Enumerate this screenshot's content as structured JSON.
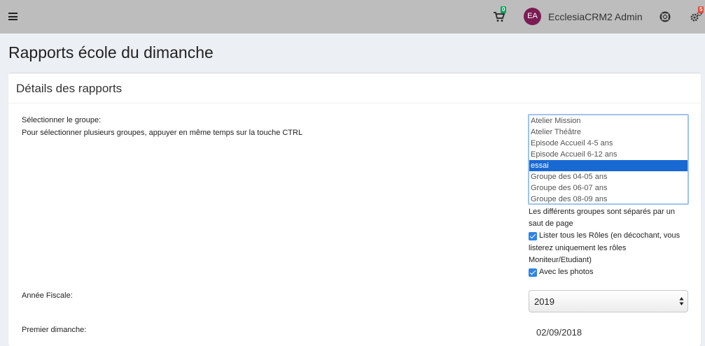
{
  "header": {
    "cart_count": "0",
    "user_initials": "EA",
    "user_name": "EcclesiaCRM2 Admin",
    "settings_badge": "5",
    "bar_color": "#bdbdbd",
    "avatar_color": "#7b1c54"
  },
  "page": {
    "title": "Rapports école du dimanche"
  },
  "panel": {
    "title": "Détails des rapports",
    "group_label": "Sélectionner le groupe:",
    "group_hint": "Pour sélectionner plusieurs groupes, appuyer en même temps sur la touche CTRL",
    "groups": [
      {
        "label": "Atelier Mission",
        "selected": false
      },
      {
        "label": "Atelier Théâtre",
        "selected": false
      },
      {
        "label": "Episode Accueil 4-5 ans",
        "selected": false
      },
      {
        "label": "Episode Accueil 6-12 ans",
        "selected": false
      },
      {
        "label": "essai",
        "selected": true
      },
      {
        "label": "Groupe des 04-05 ans",
        "selected": false
      },
      {
        "label": "Groupe des 06-07 ans",
        "selected": false
      },
      {
        "label": "Groupe des 08-09 ans",
        "selected": false
      }
    ],
    "separate_note_line1": "Les différents groupes sont séparés par un",
    "separate_note_line2": "saut de page",
    "roles_line1": "Lister tous les Rôles (en décochant, vous",
    "roles_line2": "listerez uniquement les rôles",
    "roles_line3": "Moniteur/Etudiant)",
    "roles_checked": true,
    "photos_label": "Avec les photos",
    "photos_checked": true,
    "fiscal_year_label": "Année Fiscale:",
    "fiscal_year_value": "2019",
    "first_sunday_label": "Premier dimanche:",
    "first_sunday_value": "02/09/2018",
    "selection_color": "#1969d3",
    "checkbox_color": "#2f84e6"
  },
  "icons": {
    "menu": "hamburger-icon",
    "cart": "cart-icon",
    "help": "lifering-icon",
    "settings": "gears-icon"
  }
}
